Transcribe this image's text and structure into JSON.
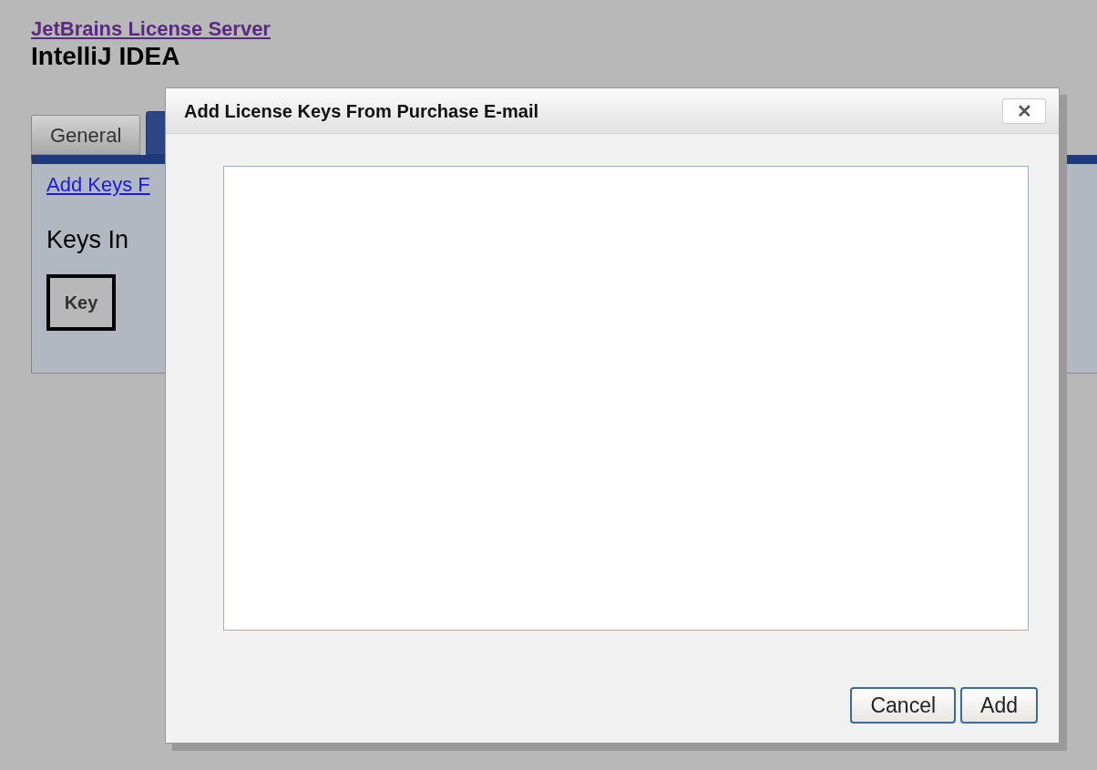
{
  "page": {
    "link": "JetBrains License Server",
    "title": "IntelliJ IDEA"
  },
  "tabs": [
    {
      "label": "General",
      "selected": false
    },
    {
      "selected": true
    }
  ],
  "panel": {
    "link": "Add Keys F",
    "heading": "Keys In",
    "column_header": "Key"
  },
  "dialog": {
    "title": "Add License Keys From Purchase E-mail",
    "close": "✕",
    "buttons": [
      "Cancel",
      "Add"
    ]
  }
}
